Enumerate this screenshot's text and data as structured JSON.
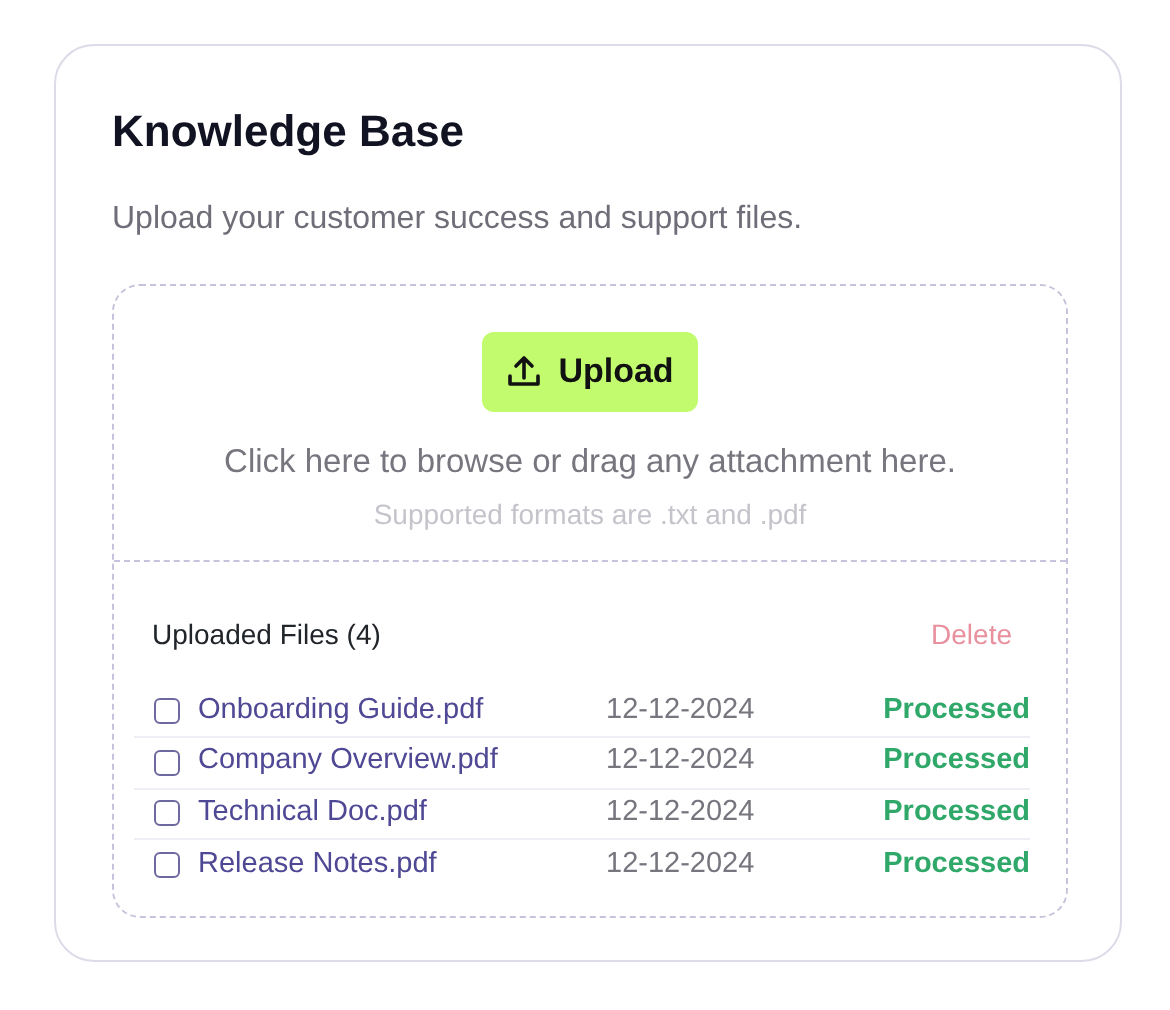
{
  "title": "Knowledge Base",
  "subtitle": "Upload your customer success and support files.",
  "dropzone": {
    "button": "Upload",
    "hint": "Click here to browse or drag any attachment here.",
    "formats": "Supported formats are .txt and .pdf"
  },
  "files_header": {
    "label": "Uploaded Files (4)",
    "delete": {
      "label": "Delete",
      "disabled": true
    }
  },
  "files": [
    {
      "name": "Onboarding Guide.pdf",
      "date": "12-12-2024",
      "status": "Processed",
      "checked": false
    },
    {
      "name": "Company Overview.pdf",
      "date": "12-12-2024",
      "status": "Processed",
      "checked": false
    },
    {
      "name": "Technical Doc.pdf",
      "date": "12-12-2024",
      "status": "Processed",
      "checked": false
    },
    {
      "name": "Release Notes.pdf",
      "date": "12-12-2024",
      "status": "Processed",
      "checked": false
    }
  ]
}
